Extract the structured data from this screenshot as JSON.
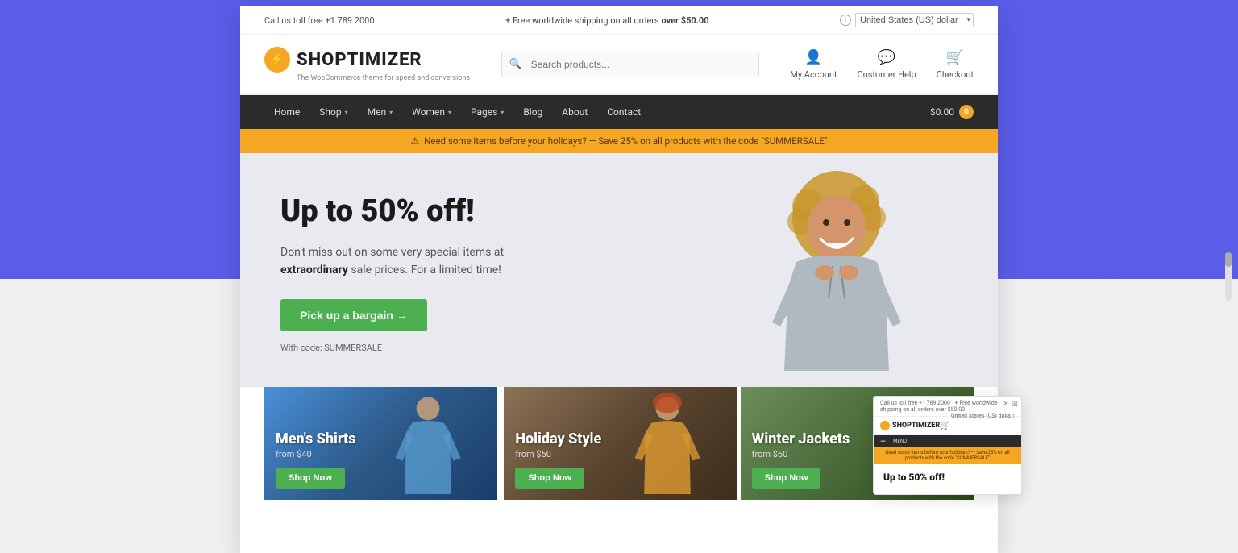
{
  "topbar": {
    "phone": "Call us toll free +1 789 2000",
    "shipping": "Free worldwide shipping on all orders",
    "shipping_bold": "over $50.00",
    "currency": "United States (US) dollar"
  },
  "header": {
    "logo_text": "SHOPTIMIZER",
    "logo_sub": "The WooCommerce theme for speed and conversions",
    "search_placeholder": "Search products...",
    "account_label": "My Account",
    "help_label": "Customer Help",
    "checkout_label": "Checkout",
    "cart_amount": "$0.00",
    "cart_count": "0"
  },
  "nav": {
    "items": [
      {
        "label": "Home",
        "has_dropdown": false
      },
      {
        "label": "Shop",
        "has_dropdown": true
      },
      {
        "label": "Men",
        "has_dropdown": true
      },
      {
        "label": "Women",
        "has_dropdown": true
      },
      {
        "label": "Pages",
        "has_dropdown": true
      },
      {
        "label": "Blog",
        "has_dropdown": false
      },
      {
        "label": "About",
        "has_dropdown": false
      },
      {
        "label": "Contact",
        "has_dropdown": false
      }
    ]
  },
  "promo_banner": {
    "text": "Need some items before your holidays? — Save 25% on all products with the code \"SUMMERSALE\""
  },
  "hero": {
    "title": "Up to 50% off!",
    "desc_line1": "Don't miss out on some very special items at",
    "desc_bold": "extraordinary",
    "desc_line2": "sale prices. For a limited time!",
    "btn_label": "Pick up a bargain →",
    "code_label": "With code: SUMMERSALE"
  },
  "products": [
    {
      "title": "Men's Shirts",
      "price": "from $40",
      "btn": "Shop Now",
      "card_class": "card-mens"
    },
    {
      "title": "Holiday Style",
      "price": "from $50",
      "btn": "Shop Now",
      "card_class": "card-holiday"
    },
    {
      "title": "Winter Jackets",
      "price": "from $60",
      "btn": "Shop Now",
      "card_class": "card-winter"
    }
  ],
  "mini_preview": {
    "topbar_text": "+ Free worldwide shipping on all orders over $50.00",
    "logo_text": "SHOPTIMIZER",
    "promo_text": "Need some items before your holidays? — Save 25% on all products with the code \"SUMMERSALE\"",
    "hero_title": "Up to 50% off!"
  },
  "colors": {
    "promo_bg": "#f5a623",
    "btn_green": "#4caf50",
    "nav_bg": "#2b2b2b",
    "hero_bg": "#e8eaf0",
    "accent": "#f5a623"
  }
}
